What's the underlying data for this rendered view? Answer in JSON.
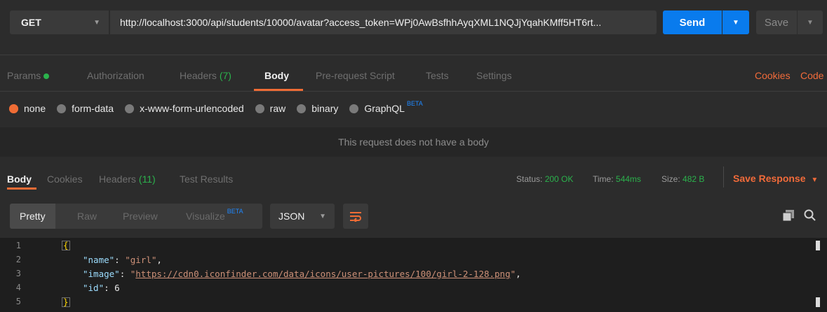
{
  "request": {
    "method": "GET",
    "url": "http://localhost:3000/api/students/10000/avatar?access_token=WPj0AwBsfhhAyqXML1NQJjYqahKMff5HT6rt...",
    "send_label": "Send",
    "save_label": "Save"
  },
  "request_tabs": {
    "params": "Params",
    "authorization": "Authorization",
    "headers": "Headers",
    "headers_count": "(7)",
    "body": "Body",
    "pre_request": "Pre-request Script",
    "tests": "Tests",
    "settings": "Settings",
    "cookies": "Cookies",
    "code": "Code"
  },
  "body_types": {
    "none": "none",
    "form_data": "form-data",
    "urlencoded": "x-www-form-urlencoded",
    "raw": "raw",
    "binary": "binary",
    "graphql": "GraphQL",
    "beta": "BETA",
    "selected": "none"
  },
  "no_body_message": "This request does not have a body",
  "response_tabs": {
    "body": "Body",
    "cookies": "Cookies",
    "headers": "Headers",
    "headers_count": "(11)",
    "test_results": "Test Results"
  },
  "status": {
    "status_label": "Status:",
    "status_value": "200 OK",
    "time_label": "Time:",
    "time_value": "544ms",
    "size_label": "Size:",
    "size_value": "482 B",
    "save_response": "Save Response"
  },
  "view": {
    "pretty": "Pretty",
    "raw": "Raw",
    "preview": "Preview",
    "visualize": "Visualize",
    "beta": "BETA",
    "format": "JSON"
  },
  "code": {
    "line_numbers": [
      "1",
      "2",
      "3",
      "4",
      "5"
    ],
    "open": "{",
    "close": "}",
    "name_key": "\"name\"",
    "name_value": "\"girl\"",
    "image_key": "\"image\"",
    "image_value": "https://cdn0.iconfinder.com/data/icons/user-pictures/100/girl-2-128.png",
    "id_key": "\"id\"",
    "id_value": "6"
  },
  "colors": {
    "accent": "#ef6c35",
    "send": "#097bed",
    "success": "#2bb24c",
    "beta": "#1e88ff"
  },
  "icons": [
    "caret-down-icon",
    "wrap-lines-icon",
    "copy-icon",
    "search-icon",
    "radio-icon"
  ]
}
